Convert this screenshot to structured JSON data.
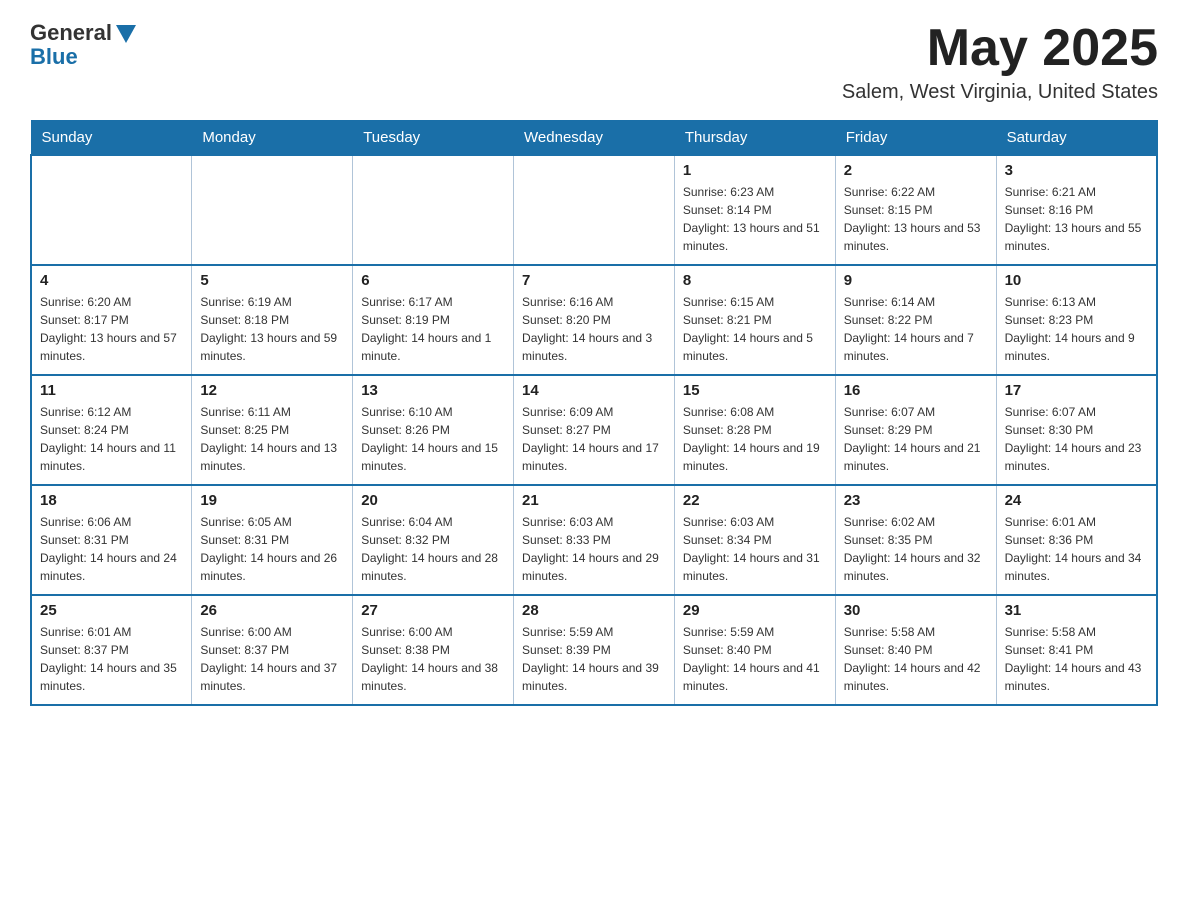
{
  "header": {
    "logo_general": "General",
    "logo_blue": "Blue",
    "month_year": "May 2025",
    "location": "Salem, West Virginia, United States"
  },
  "days_of_week": [
    "Sunday",
    "Monday",
    "Tuesday",
    "Wednesday",
    "Thursday",
    "Friday",
    "Saturday"
  ],
  "weeks": [
    [
      {
        "num": "",
        "info": ""
      },
      {
        "num": "",
        "info": ""
      },
      {
        "num": "",
        "info": ""
      },
      {
        "num": "",
        "info": ""
      },
      {
        "num": "1",
        "info": "Sunrise: 6:23 AM\nSunset: 8:14 PM\nDaylight: 13 hours and 51 minutes."
      },
      {
        "num": "2",
        "info": "Sunrise: 6:22 AM\nSunset: 8:15 PM\nDaylight: 13 hours and 53 minutes."
      },
      {
        "num": "3",
        "info": "Sunrise: 6:21 AM\nSunset: 8:16 PM\nDaylight: 13 hours and 55 minutes."
      }
    ],
    [
      {
        "num": "4",
        "info": "Sunrise: 6:20 AM\nSunset: 8:17 PM\nDaylight: 13 hours and 57 minutes."
      },
      {
        "num": "5",
        "info": "Sunrise: 6:19 AM\nSunset: 8:18 PM\nDaylight: 13 hours and 59 minutes."
      },
      {
        "num": "6",
        "info": "Sunrise: 6:17 AM\nSunset: 8:19 PM\nDaylight: 14 hours and 1 minute."
      },
      {
        "num": "7",
        "info": "Sunrise: 6:16 AM\nSunset: 8:20 PM\nDaylight: 14 hours and 3 minutes."
      },
      {
        "num": "8",
        "info": "Sunrise: 6:15 AM\nSunset: 8:21 PM\nDaylight: 14 hours and 5 minutes."
      },
      {
        "num": "9",
        "info": "Sunrise: 6:14 AM\nSunset: 8:22 PM\nDaylight: 14 hours and 7 minutes."
      },
      {
        "num": "10",
        "info": "Sunrise: 6:13 AM\nSunset: 8:23 PM\nDaylight: 14 hours and 9 minutes."
      }
    ],
    [
      {
        "num": "11",
        "info": "Sunrise: 6:12 AM\nSunset: 8:24 PM\nDaylight: 14 hours and 11 minutes."
      },
      {
        "num": "12",
        "info": "Sunrise: 6:11 AM\nSunset: 8:25 PM\nDaylight: 14 hours and 13 minutes."
      },
      {
        "num": "13",
        "info": "Sunrise: 6:10 AM\nSunset: 8:26 PM\nDaylight: 14 hours and 15 minutes."
      },
      {
        "num": "14",
        "info": "Sunrise: 6:09 AM\nSunset: 8:27 PM\nDaylight: 14 hours and 17 minutes."
      },
      {
        "num": "15",
        "info": "Sunrise: 6:08 AM\nSunset: 8:28 PM\nDaylight: 14 hours and 19 minutes."
      },
      {
        "num": "16",
        "info": "Sunrise: 6:07 AM\nSunset: 8:29 PM\nDaylight: 14 hours and 21 minutes."
      },
      {
        "num": "17",
        "info": "Sunrise: 6:07 AM\nSunset: 8:30 PM\nDaylight: 14 hours and 23 minutes."
      }
    ],
    [
      {
        "num": "18",
        "info": "Sunrise: 6:06 AM\nSunset: 8:31 PM\nDaylight: 14 hours and 24 minutes."
      },
      {
        "num": "19",
        "info": "Sunrise: 6:05 AM\nSunset: 8:31 PM\nDaylight: 14 hours and 26 minutes."
      },
      {
        "num": "20",
        "info": "Sunrise: 6:04 AM\nSunset: 8:32 PM\nDaylight: 14 hours and 28 minutes."
      },
      {
        "num": "21",
        "info": "Sunrise: 6:03 AM\nSunset: 8:33 PM\nDaylight: 14 hours and 29 minutes."
      },
      {
        "num": "22",
        "info": "Sunrise: 6:03 AM\nSunset: 8:34 PM\nDaylight: 14 hours and 31 minutes."
      },
      {
        "num": "23",
        "info": "Sunrise: 6:02 AM\nSunset: 8:35 PM\nDaylight: 14 hours and 32 minutes."
      },
      {
        "num": "24",
        "info": "Sunrise: 6:01 AM\nSunset: 8:36 PM\nDaylight: 14 hours and 34 minutes."
      }
    ],
    [
      {
        "num": "25",
        "info": "Sunrise: 6:01 AM\nSunset: 8:37 PM\nDaylight: 14 hours and 35 minutes."
      },
      {
        "num": "26",
        "info": "Sunrise: 6:00 AM\nSunset: 8:37 PM\nDaylight: 14 hours and 37 minutes."
      },
      {
        "num": "27",
        "info": "Sunrise: 6:00 AM\nSunset: 8:38 PM\nDaylight: 14 hours and 38 minutes."
      },
      {
        "num": "28",
        "info": "Sunrise: 5:59 AM\nSunset: 8:39 PM\nDaylight: 14 hours and 39 minutes."
      },
      {
        "num": "29",
        "info": "Sunrise: 5:59 AM\nSunset: 8:40 PM\nDaylight: 14 hours and 41 minutes."
      },
      {
        "num": "30",
        "info": "Sunrise: 5:58 AM\nSunset: 8:40 PM\nDaylight: 14 hours and 42 minutes."
      },
      {
        "num": "31",
        "info": "Sunrise: 5:58 AM\nSunset: 8:41 PM\nDaylight: 14 hours and 43 minutes."
      }
    ]
  ]
}
